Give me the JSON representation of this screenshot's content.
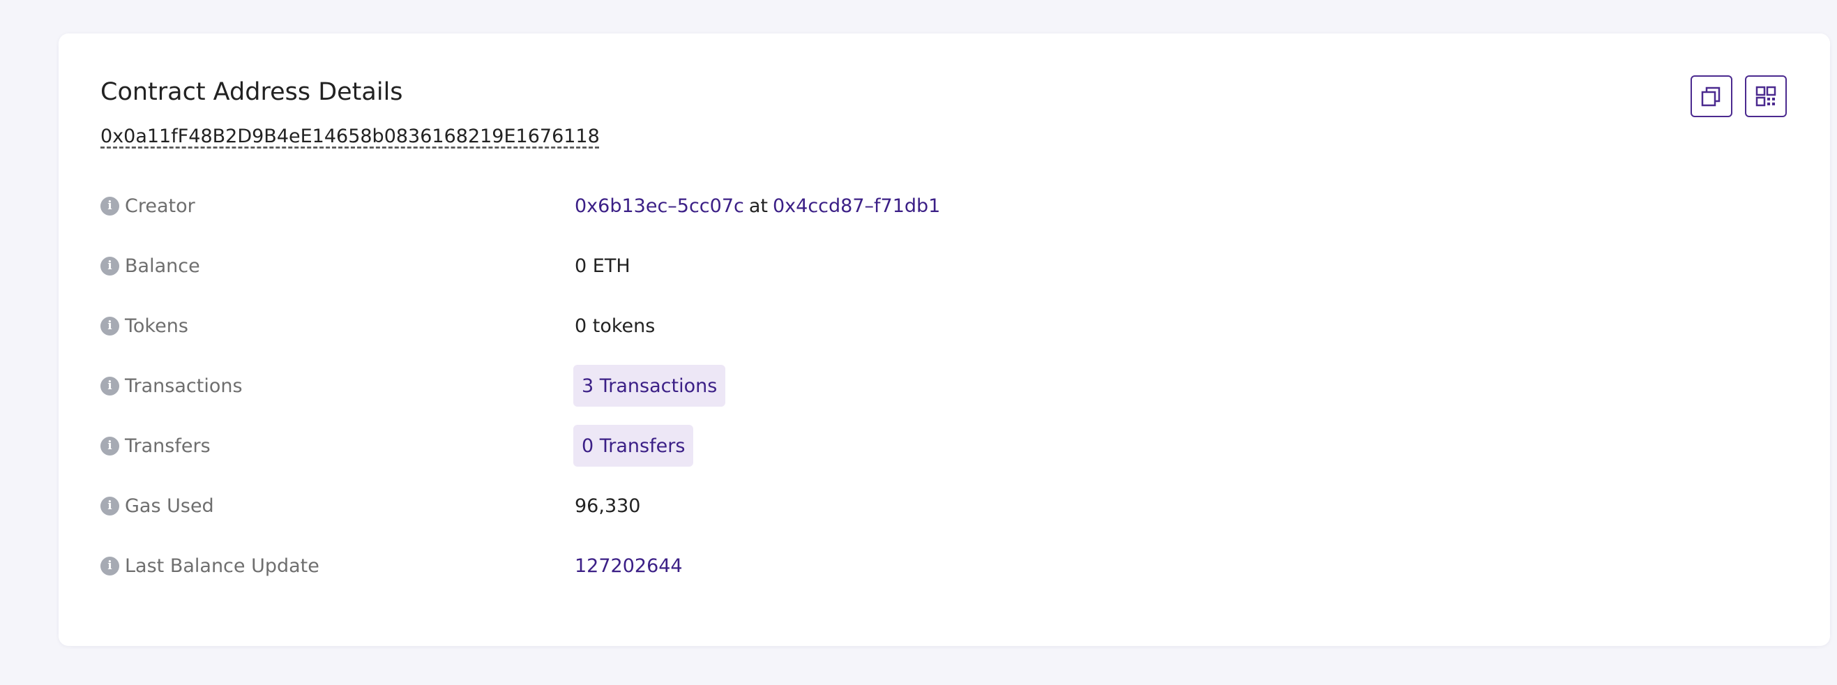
{
  "header": {
    "title": "Contract Address Details",
    "address": "0x0a11fF48B2D9B4eE14658b0836168219E1676118"
  },
  "actions": {
    "copy_icon": "copy-icon",
    "qr_icon": "qr-code-icon"
  },
  "details": {
    "creator": {
      "label": "Creator",
      "creator_address": "0x6b13ec–5cc07c",
      "at_text": "at",
      "tx_hash": "0x4ccd87–f71db1"
    },
    "balance": {
      "label": "Balance",
      "value": "0 ETH"
    },
    "tokens": {
      "label": "Tokens",
      "value": "0 tokens"
    },
    "transactions": {
      "label": "Transactions",
      "value": "3 Transactions"
    },
    "transfers": {
      "label": "Transfers",
      "value": "0 Transfers"
    },
    "gas_used": {
      "label": "Gas Used",
      "value": "96,330"
    },
    "last_balance_update": {
      "label": "Last Balance Update",
      "value": "127202644"
    }
  },
  "colors": {
    "accent": "#3b1f86",
    "pill_background": "#ede7f6",
    "info_icon": "#a6aab3"
  }
}
